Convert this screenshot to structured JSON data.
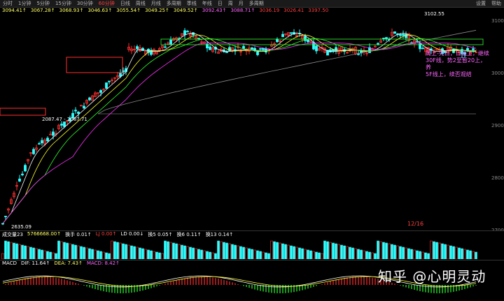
{
  "toolbar": {
    "items": [
      "分时",
      "1分钟",
      "5分钟",
      "15分钟",
      "30分钟",
      "60分钟",
      "日线",
      "周线",
      "月线",
      "多周期",
      "季线",
      "年线",
      "日",
      "周",
      "月",
      "多周期"
    ],
    "active_index": 5,
    "right_items": [
      "设置",
      "帮助"
    ]
  },
  "infobar": {
    "items": [
      {
        "text": "3094.41↑",
        "color": "#ffff66"
      },
      {
        "text": "3067.28↑",
        "color": "#ffff66"
      },
      {
        "text": "3068.93↑",
        "color": "#ffff66"
      },
      {
        "text": "3046.63↑",
        "color": "#ffff66"
      },
      {
        "text": "3055.54↑",
        "color": "#ffff66"
      },
      {
        "text": "3049.25↑",
        "color": "#ffff66"
      },
      {
        "text": "3049.52↑",
        "color": "#ffff66"
      },
      {
        "text": "3092.43↑",
        "color": "#ff66ff"
      },
      {
        "text": "3088.71↑",
        "color": "#ff66ff"
      },
      {
        "text": "3036.19",
        "color": "#ff4040"
      },
      {
        "text": "3026.41",
        "color": "#ff4040"
      },
      {
        "text": "3397.50",
        "color": "#ff4040"
      }
    ]
  },
  "chart": {
    "price_labels": [
      {
        "text": "3102.55",
        "color": "#fff"
      },
      {
        "text": "2635.09",
        "color": "#fff"
      },
      {
        "text": "2087.47 - 2087.71",
        "color": "#fff"
      }
    ],
    "note_lines": [
      "周上-先日，日线上，继续",
      "30F线，势2至暂20上，养",
      "5F线上，续否观结"
    ],
    "pager": "12/16",
    "right_axis": [
      "3100",
      "3000",
      "2900",
      "2800",
      "2700"
    ]
  },
  "volume": {
    "label": "成交量23",
    "items": [
      {
        "text": "5766668.00↑",
        "color": "#ffff66"
      },
      {
        "text": "换手 0.01↑",
        "color": "#fff"
      },
      {
        "text": "LJ 0.00↑",
        "color": "#ff4040"
      },
      {
        "text": "LD 0.00↓",
        "color": "#fff"
      },
      {
        "text": "换5 0.05↑",
        "color": "#fff"
      },
      {
        "text": "换6 0.11↑",
        "color": "#fff"
      },
      {
        "text": "换13 0.14↑",
        "color": "#fff"
      }
    ]
  },
  "macd": {
    "label": "MACD",
    "items": [
      {
        "text": "DIF: 11.64↑",
        "color": "#fff"
      },
      {
        "text": "DEA: 7.43↑",
        "color": "#ffff66"
      },
      {
        "text": "MACD: 8.42↑",
        "color": "#ff66ff"
      }
    ]
  },
  "watermark": "知乎 @心明灵动",
  "colors": {
    "up": "#ff3030",
    "down": "#30ffff",
    "ma1": "#ffffff",
    "ma2": "#ffff30",
    "ma3": "#30ff30",
    "ma4": "#ff30ff",
    "ma5": "#888888"
  }
}
